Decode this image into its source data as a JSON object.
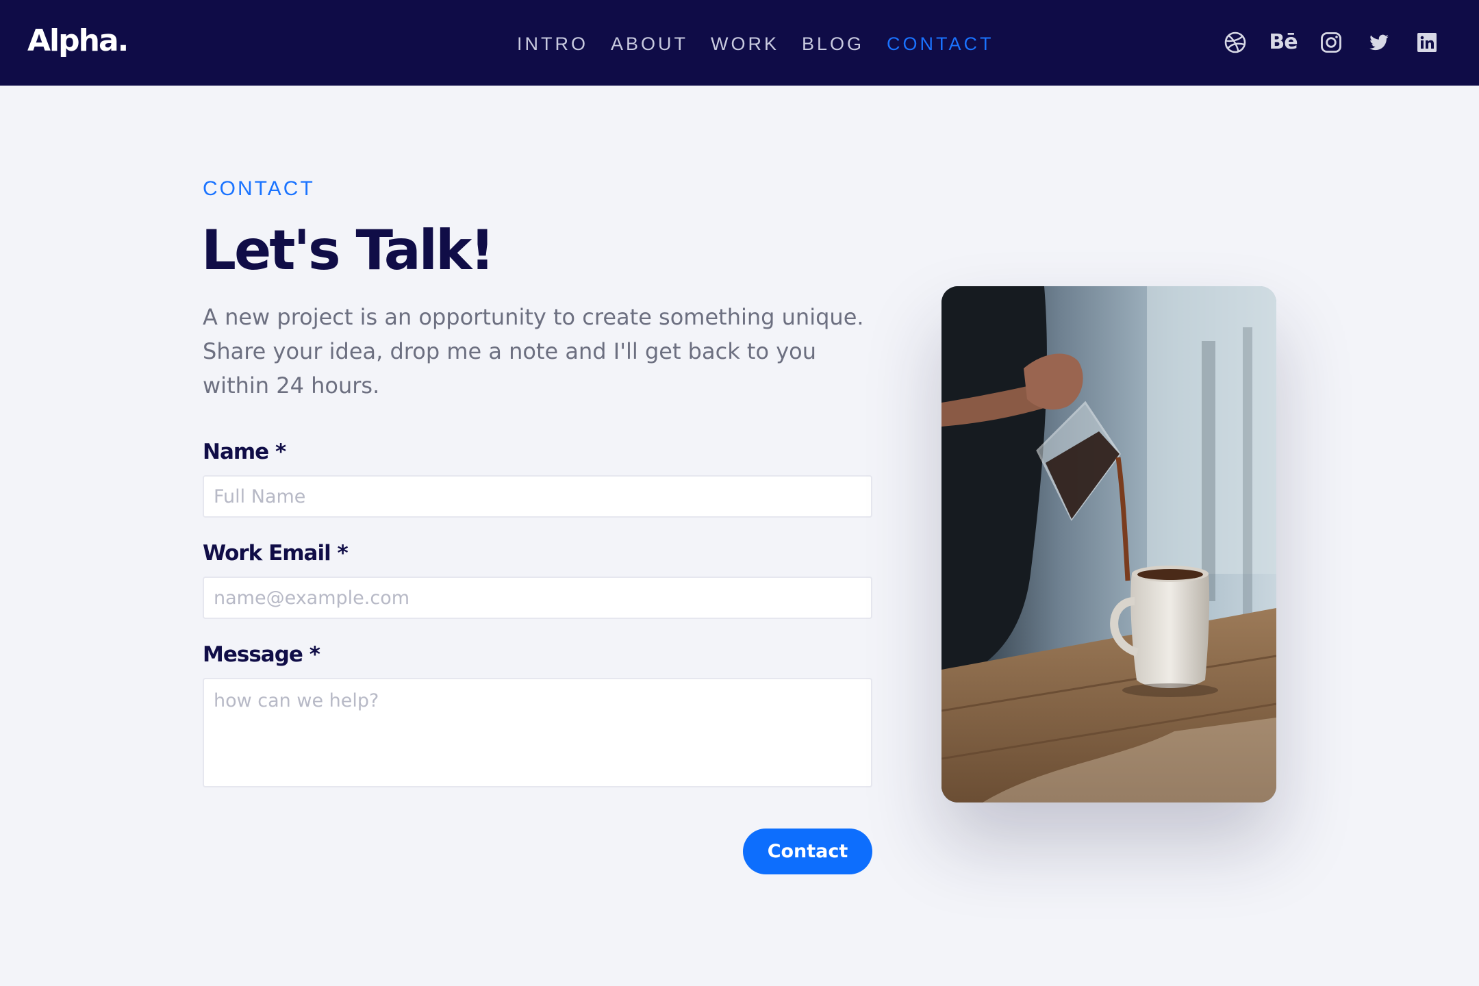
{
  "brand": {
    "logo": "Alpha.",
    "accent_color": "#1a73ff",
    "nav_background": "#0f0c47",
    "heading_color": "#100d47"
  },
  "nav": {
    "links": [
      {
        "label": "INTRO",
        "active": false
      },
      {
        "label": "ABOUT",
        "active": false
      },
      {
        "label": "WORK",
        "active": false
      },
      {
        "label": "BLOG",
        "active": false
      },
      {
        "label": "CONTACT",
        "active": true
      }
    ]
  },
  "social": {
    "icons": [
      "dribbble-icon",
      "behance-icon",
      "instagram-icon",
      "twitter-icon",
      "linkedin-icon"
    ],
    "behance_text": "Bē"
  },
  "contact": {
    "eyebrow": "CONTACT",
    "title": "Let's Talk!",
    "lead": "A new project is an opportunity to create something unique. Share your idea, drop me a note and I'll get back to you within 24 hours.",
    "fields": {
      "name": {
        "label": "Name *",
        "placeholder": "Full Name",
        "value": ""
      },
      "email": {
        "label": "Work Email *",
        "placeholder": "name@example.com",
        "value": ""
      },
      "message": {
        "label": "Message *",
        "placeholder": "how can we help?",
        "value": ""
      }
    },
    "submit_label": "Contact"
  }
}
